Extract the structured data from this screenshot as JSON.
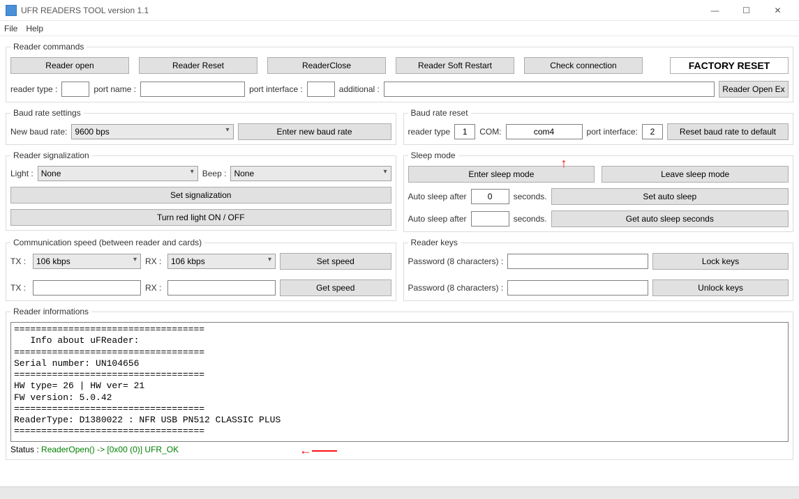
{
  "window": {
    "title": "UFR READERS TOOL version 1.1",
    "min": "—",
    "max": "☐",
    "close": "✕"
  },
  "menu": {
    "file": "File",
    "help": "Help"
  },
  "reader_commands": {
    "legend": "Reader commands",
    "btn_open": "Reader open",
    "btn_reset": "Reader Reset",
    "btn_close": "ReaderClose",
    "btn_soft": "Reader Soft Restart",
    "btn_check": "Check connection",
    "btn_factory": "FACTORY RESET",
    "lbl_reader_type": "reader type :",
    "val_reader_type": "",
    "lbl_port_name": "port name :",
    "val_port_name": "",
    "lbl_port_if": "port interface :",
    "val_port_if": "",
    "lbl_additional": "additional :",
    "val_additional": "",
    "btn_open_ex": "Reader Open Ex"
  },
  "baud_settings": {
    "legend": "Baud rate settings",
    "lbl_new": "New baud rate:",
    "val_sel": "9600 bps",
    "btn_enter": "Enter new baud rate"
  },
  "baud_reset": {
    "legend": "Baud rate reset",
    "lbl_rt": "reader type",
    "val_rt": "1",
    "lbl_com": "COM:",
    "val_com": "com4",
    "lbl_pi": "port interface:",
    "val_pi": "2",
    "btn_reset": "Reset baud rate to default"
  },
  "signal": {
    "legend": "Reader signalization",
    "lbl_light": "Light :",
    "val_light": "None",
    "lbl_beep": "Beep :",
    "val_beep": "None",
    "btn_set": "Set signalization",
    "btn_red": "Turn red light ON / OFF"
  },
  "sleep": {
    "legend": "Sleep mode",
    "btn_enter": "Enter sleep mode",
    "btn_leave": "Leave sleep mode",
    "lbl_auto1": "Auto sleep after",
    "val_auto1": "0",
    "lbl_secs": "seconds.",
    "btn_set": "Set auto sleep",
    "lbl_auto2": "Auto sleep after",
    "val_auto2": "",
    "btn_get": "Get auto sleep seconds"
  },
  "comm": {
    "legend": "Communication speed (between reader and cards)",
    "lbl_tx": "TX :",
    "val_tx": "106 kbps",
    "lbl_rx": "RX :",
    "val_rx": "106 kbps",
    "btn_set": "Set speed",
    "lbl_tx2": "TX :",
    "val_tx2": "",
    "lbl_rx2": "RX :",
    "val_rx2": "",
    "btn_get": "Get speed"
  },
  "keys": {
    "legend": "Reader keys",
    "lbl_pw": "Password (8 characters) :",
    "btn_lock": "Lock keys",
    "btn_unlock": "Unlock keys",
    "val_pw1": "",
    "val_pw2": ""
  },
  "infos": {
    "legend": "Reader informations",
    "text": "===================================\n   Info about uFReader:\n===================================\nSerial number: UN104656\n===================================\nHW type= 26 | HW ver= 21\nFW version: 5.0.42\n===================================\nReaderType: D1380022 : NFR USB PN512 CLASSIC PLUS\n===================================",
    "status_lbl": "Status : ",
    "status_val": " ReaderOpen() -> [0x00 (0)] UFR_OK"
  }
}
